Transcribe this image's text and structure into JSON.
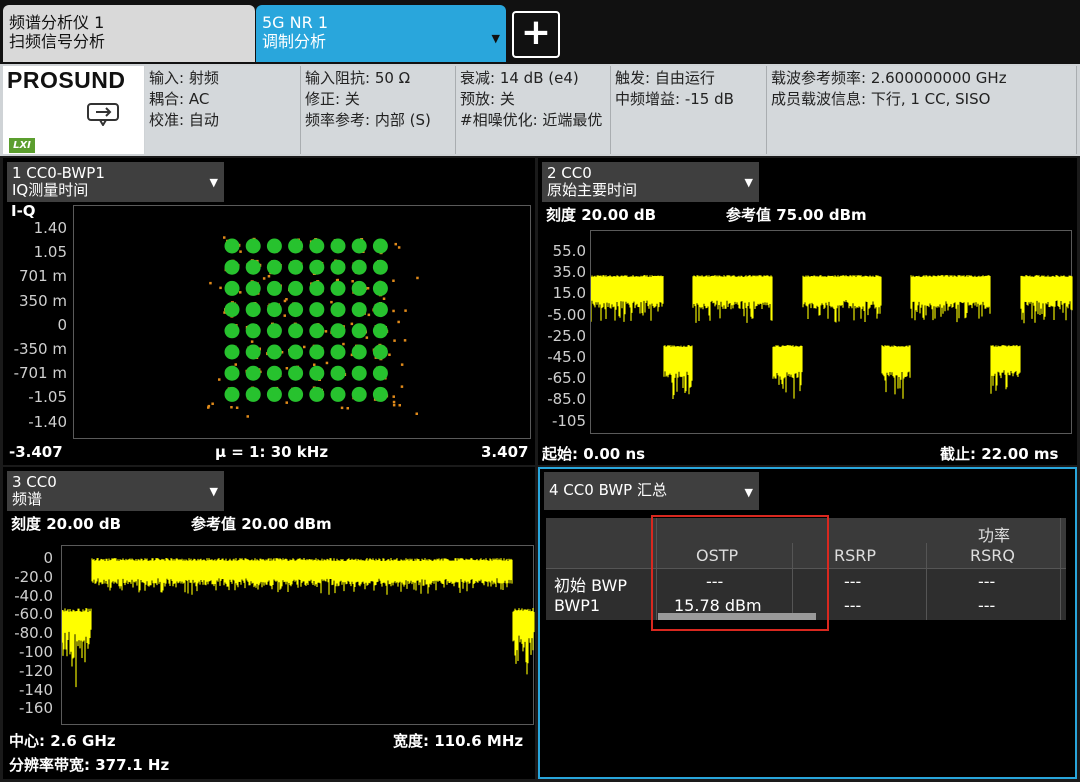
{
  "tabs": [
    {
      "line1": "频谱分析仪 1",
      "line2": "扫频信号分析"
    },
    {
      "line1": "5G NR 1",
      "line2": "调制分析"
    }
  ],
  "add_label": "+",
  "logo": "PROSUND",
  "lxi": "LXI",
  "info": [
    [
      "输入: 射频",
      "耦合: AC",
      "校准: 自动"
    ],
    [
      "输入阻抗: 50 Ω",
      "修正: 关",
      "频率参考: 内部 (S)"
    ],
    [
      "衰减: 14 dB (e4)",
      "预放: 关",
      "#相噪优化: 近端最优"
    ],
    [
      "触发: 自由运行",
      "中频增益: -15 dB"
    ],
    [
      "载波参考频率: 2.600000000 GHz",
      "成员载波信息: 下行, 1 CC, SISO"
    ]
  ],
  "panel1": {
    "title1": "1 CC0-BWP1",
    "title2": "IQ测量时间",
    "axis_label": "I-Q",
    "yticks": [
      "1.40",
      "1.05",
      "701 m",
      "350 m",
      "0",
      "-350 m",
      "-701 m",
      "-1.05",
      "-1.40"
    ],
    "x_left": "-3.407",
    "x_center": "μ = 1: 30 kHz",
    "x_right": "3.407",
    "colors": {
      "symbols": "#27c22e",
      "scatter": "#e08a1a"
    }
  },
  "panel2": {
    "title1": "2 CC0",
    "title2": "原始主要时间",
    "scale": "刻度 20.00 dB",
    "ref": "参考值 75.00 dBm",
    "yticks": [
      "55.0",
      "35.0",
      "15.0",
      "-5.00",
      "-25.0",
      "-45.0",
      "-65.0",
      "-85.0",
      "-105"
    ],
    "start": "起始: 0.00 ns",
    "stop": "截止: 22.00 ms",
    "trace_color": "#ffff00"
  },
  "panel3": {
    "title1": "3 CC0",
    "title2": "频谱",
    "scale": "刻度 20.00 dB",
    "ref": "参考值 20.00 dBm",
    "yticks": [
      "0",
      "-20.0",
      "-40.0",
      "-60.0",
      "-80.0",
      "-100",
      "-120",
      "-140",
      "-160"
    ],
    "center": "中心: 2.6 GHz",
    "span": "宽度: 110.6 MHz",
    "rbw": "分辨率带宽: 377.1 Hz",
    "trace_color": "#ffff00"
  },
  "panel4": {
    "title": "4 CC0 BWP 汇总",
    "group_header": "功率",
    "columns": [
      "OSTP",
      "RSRP",
      "RSRQ"
    ],
    "rows": [
      {
        "label": "初始 BWP",
        "values": [
          "---",
          "---",
          "---"
        ]
      },
      {
        "label": "BWP1",
        "values": [
          "15.78 dBm",
          "---",
          "---"
        ]
      }
    ],
    "highlight_color": "#d9281f"
  }
}
